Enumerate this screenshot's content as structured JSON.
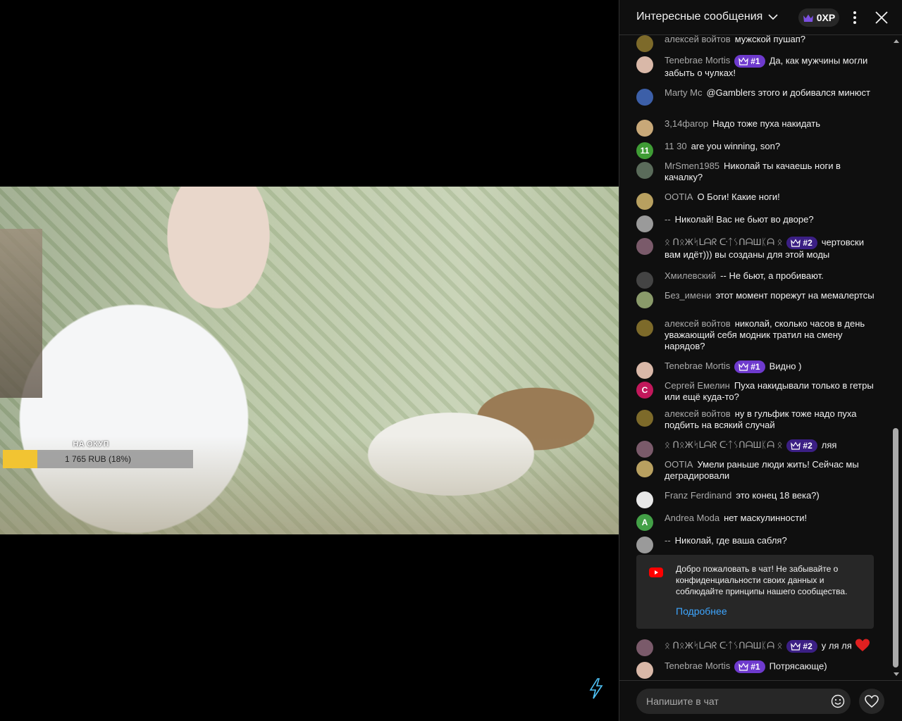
{
  "video": {
    "goal_label": "НА ОКУП",
    "goal_amount_text": "1 765 RUB (18%)",
    "goal_progress": 0.18
  },
  "chat": {
    "header": {
      "title": "Интересные сообщения",
      "xp_text": "0XP"
    },
    "messages": [
      {
        "author": "алексей войтов",
        "text": "мужской пушап?",
        "avatar_color": "#7d6a2a",
        "avatar_letter": ""
      },
      {
        "author": "Tenebrae Mortis",
        "badge": "#1",
        "badge_style": "light",
        "text": "Да, как мужчины могли забыть о чулках!",
        "avatar_color": "#d9b8a8",
        "avatar_letter": ""
      },
      {
        "author": "Marty Mc",
        "text": "@Gamblers этого и добивался минюст",
        "avatar_color": "#3c5fa8",
        "avatar_letter": ""
      },
      {
        "author": "3,14фагор",
        "text": "Надо тоже пуха накидать",
        "avatar_color": "#c8a878",
        "avatar_letter": ""
      },
      {
        "author": "11 30",
        "text": "are you winning, son?",
        "avatar_color": "#3f9c35",
        "avatar_letter": "11"
      },
      {
        "author": "MrSmen1985",
        "text": "Николай ты качаешь ноги в качалку?",
        "avatar_color": "#5a6b5a",
        "avatar_letter": ""
      },
      {
        "author": "OOTIA",
        "text": "О Боги! Какие ноги!",
        "avatar_color": "#b8a060",
        "avatar_letter": ""
      },
      {
        "author": "--",
        "text": "Николай! Вас не бьют во дворе?",
        "avatar_color": "#9a9a9a",
        "avatar_letter": ""
      },
      {
        "author": "ᛟ ᑎᛟЖᛋᒪᗩᖇ ᑢᛏᛊᑎᗩШᛕᗩ ᛟ",
        "badge": "#2",
        "badge_style": "dark",
        "text": "чертовски вам идёт))) вы созданы для этой моды",
        "avatar_color": "#7a5a6a",
        "avatar_letter": ""
      },
      {
        "author": "Хмилевский",
        "text": "-- Не бьют, а пробивают.",
        "avatar_color": "#444",
        "avatar_letter": ""
      },
      {
        "author": "Без_имени",
        "text": "этот момент порежут на мемалертсы",
        "avatar_color": "#8a9a6a",
        "avatar_letter": ""
      },
      {
        "author": "алексей войтов",
        "text": "николай, сколько часов в день уважающий себя модник тратил на смену нарядов?",
        "avatar_color": "#7d6a2a",
        "avatar_letter": ""
      },
      {
        "author": "Tenebrae Mortis",
        "badge": "#1",
        "badge_style": "light",
        "text": "Видно )",
        "avatar_color": "#d9b8a8",
        "avatar_letter": ""
      },
      {
        "author": "Сергей Емелин",
        "text": "Пуха накидывали только в гетры или ещё куда-то?",
        "avatar_color": "#c2185b",
        "avatar_letter": "С"
      },
      {
        "author": "алексей войтов",
        "text": "ну в гульфик тоже надо пуха подбить на всякий случай",
        "avatar_color": "#7d6a2a",
        "avatar_letter": ""
      },
      {
        "author": "ᛟ ᑎᛟЖᛋᒪᗩᖇ ᑢᛏᛊᑎᗩШᛕᗩ ᛟ",
        "badge": "#2",
        "badge_style": "dark",
        "text": "ляя",
        "avatar_color": "#7a5a6a",
        "avatar_letter": ""
      },
      {
        "author": "OOTIA",
        "text": "Умели раньше люди жить! Сейчас мы деградировали",
        "avatar_color": "#b8a060",
        "avatar_letter": ""
      },
      {
        "author": "Franz Ferdinand",
        "text": "это конец 18 века?)",
        "avatar_color": "#e8e8e8",
        "avatar_letter": ""
      },
      {
        "author": "Andrea Moda",
        "text": "нет маскулинности!",
        "avatar_color": "#43a047",
        "avatar_letter": "A"
      },
      {
        "author": "--",
        "text": "Николай, где ваша сабля?",
        "avatar_color": "#9a9a9a",
        "avatar_letter": ""
      },
      {
        "author": "ᛟ ᑎᛟЖᛋᒪᗩᖇ ᑢᛏᛊᑎᗩШᛕᗩ ᛟ",
        "badge": "#2",
        "badge_style": "dark",
        "text": "у ля ля",
        "heart": true,
        "avatar_color": "#7a5a6a",
        "avatar_letter": ""
      },
      {
        "author": "Tenebrae Mortis",
        "badge": "#1",
        "badge_style": "light",
        "text": "Потрясающе)",
        "avatar_color": "#d9b8a8",
        "avatar_letter": ""
      }
    ],
    "notice": {
      "text": "Добро пожаловать в чат! Не забывайте о конфиденциальности своих данных и соблюдайте принципы нашего сообщества.",
      "link": "Подробнее"
    },
    "input": {
      "placeholder": "Напишите в чат"
    }
  }
}
